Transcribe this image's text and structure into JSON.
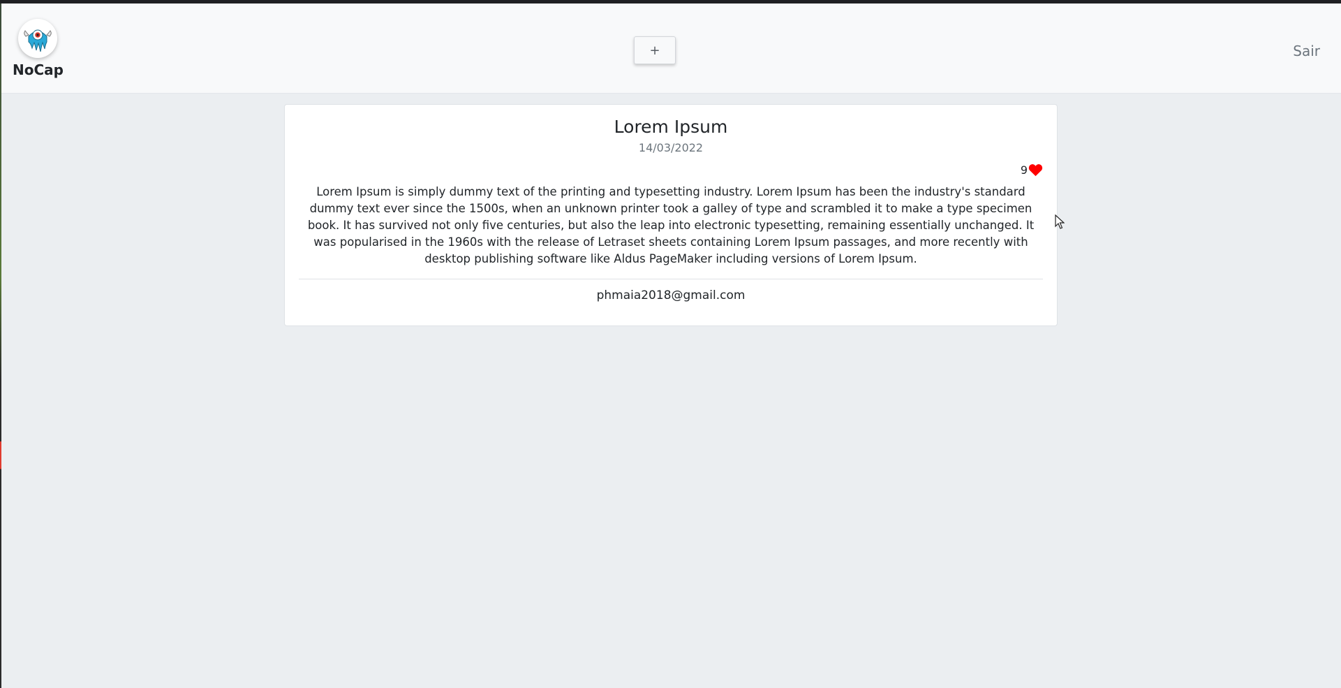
{
  "brand": {
    "name": "NoCap",
    "logo_icon": "dripping-eye-logo"
  },
  "nav": {
    "add_label": "+",
    "logout_label": "Sair"
  },
  "post": {
    "title": "Lorem Ipsum",
    "date": "14/03/2022",
    "likes": "9",
    "like_icon": "heart-icon",
    "like_color": "#ff0000",
    "body": "Lorem Ipsum is simply dummy text of the printing and typesetting industry. Lorem Ipsum has been the industry's standard dummy text ever since the 1500s, when an unknown printer took a galley of type and scrambled it to make a type specimen book. It has survived not only five centuries, but also the leap into electronic typesetting, remaining essentially unchanged. It was popularised in the 1960s with the release of Letraset sheets containing Lorem Ipsum passages, and more recently with desktop publishing software like Aldus PageMaker including versions of Lorem Ipsum.",
    "author": "phmaia2018@gmail.com"
  },
  "colors": {
    "background": "#ebeef1",
    "navbar": "#f8f9fa",
    "card": "#ffffff",
    "logo_accent": "#29a9d8"
  }
}
